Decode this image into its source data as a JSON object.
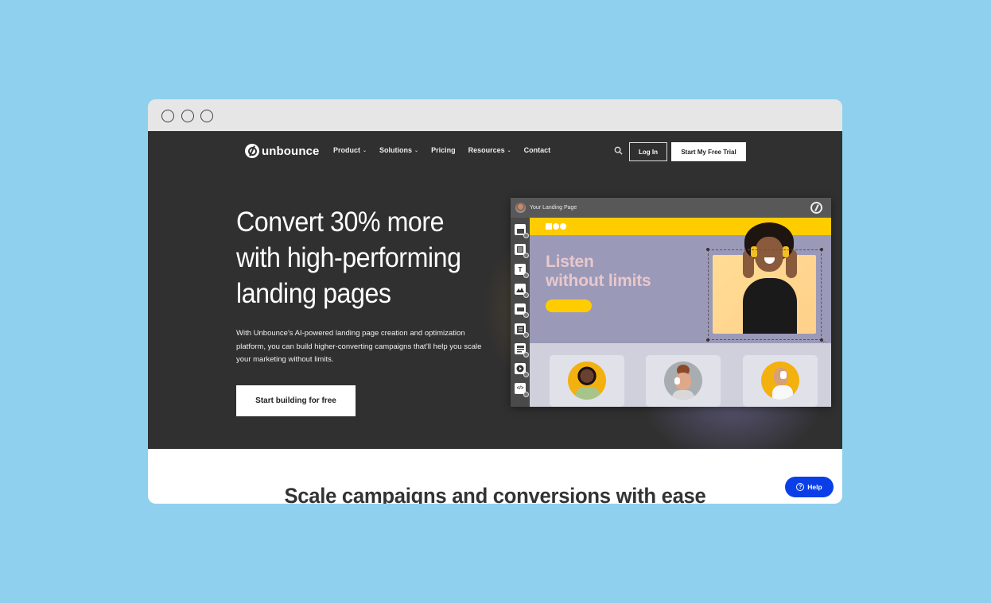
{
  "window": {
    "controls": [
      "circle",
      "circle",
      "circle"
    ]
  },
  "nav": {
    "logo_text": "unbounce",
    "links": [
      {
        "label": "Product",
        "has_dropdown": true
      },
      {
        "label": "Solutions",
        "has_dropdown": true
      },
      {
        "label": "Pricing",
        "has_dropdown": false
      },
      {
        "label": "Resources",
        "has_dropdown": true
      },
      {
        "label": "Contact",
        "has_dropdown": false
      }
    ],
    "chevron": "⌄",
    "search_icon": "search-icon",
    "login_label": "Log In",
    "trial_label": "Start My Free Trial"
  },
  "hero": {
    "headline_lines": [
      "Convert 30% more",
      "with high-performing",
      "landing pages"
    ],
    "subcopy": "With Unbounce's AI-powered landing page creation and optimization platform, you can build higher-converting campaigns that’ll help you scale your marketing without limits.",
    "cta_label": "Start building for free"
  },
  "builder": {
    "title": "Your Landing Page",
    "tools": [
      "section-icon",
      "box-icon",
      "text-icon",
      "image-icon",
      "button-icon",
      "form-icon",
      "list-icon",
      "video-icon",
      "code-icon"
    ],
    "tool_text_glyph": "T",
    "tool_code_glyph": "</>",
    "canvas": {
      "headline_lines": [
        "Listen",
        "without limits"
      ]
    }
  },
  "lower": {
    "title": "Scale campaigns and conversions with ease"
  },
  "help": {
    "icon_glyph": "?",
    "label": "Help"
  },
  "colors": {
    "background": "#8fd0ee",
    "hero_bg": "#303030",
    "accent_yellow": "#ffcc00",
    "canvas_purple": "#9b99b8",
    "help_blue": "#0a3fe8"
  }
}
